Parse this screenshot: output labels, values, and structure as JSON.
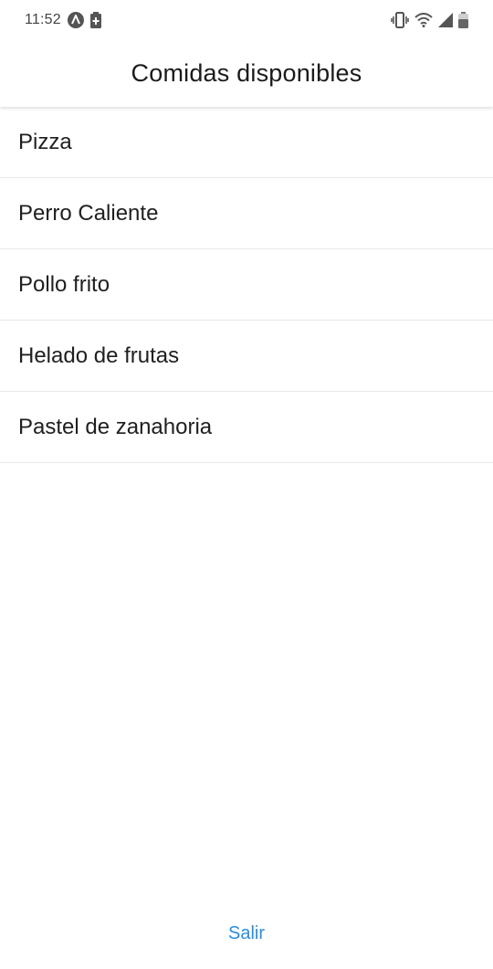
{
  "status_bar": {
    "time": "11:52",
    "left_icons": [
      "app-a-icon",
      "battery-saver-icon"
    ],
    "right_icons": [
      "vibrate-icon",
      "wifi-icon",
      "signal-icon",
      "battery-icon"
    ]
  },
  "header": {
    "title": "Comidas disponibles"
  },
  "foods": [
    {
      "label": "Pizza"
    },
    {
      "label": "Perro Caliente"
    },
    {
      "label": "Pollo frito"
    },
    {
      "label": "Helado de frutas"
    },
    {
      "label": "Pastel de zanahoria"
    }
  ],
  "footer": {
    "exit_label": "Salir"
  },
  "colors": {
    "accent": "#2a8ee0",
    "background": "#ffffff",
    "divider": "#e8e8e8"
  }
}
